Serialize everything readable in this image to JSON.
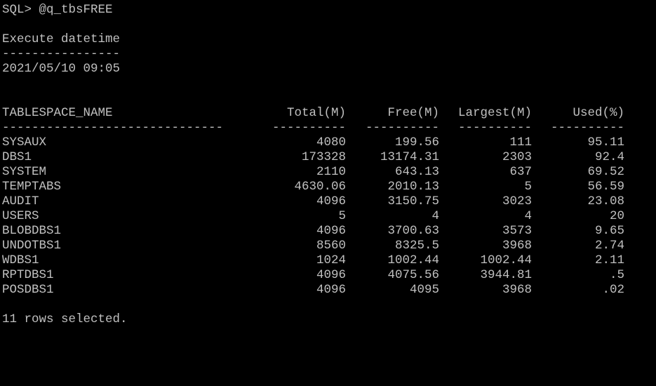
{
  "prompt": "SQL> @q_tbsFREE",
  "section": {
    "title": "Execute datetime",
    "underline": "----------------",
    "value": "2021/05/10 09:05"
  },
  "table": {
    "columns": [
      "TABLESPACE_NAME",
      "Total(M)",
      "Free(M)",
      "Largest(M)",
      "Used(%)"
    ],
    "underlines": [
      "------------------------------",
      "----------",
      "----------",
      "----------",
      "----------"
    ],
    "rows": [
      [
        "SYSAUX",
        "4080",
        "199.56",
        "111",
        "95.11"
      ],
      [
        "DBS1",
        "173328",
        "13174.31",
        "2303",
        "92.4"
      ],
      [
        "SYSTEM",
        "2110",
        "643.13",
        "637",
        "69.52"
      ],
      [
        "TEMPTABS",
        "4630.06",
        "2010.13",
        "5",
        "56.59"
      ],
      [
        "AUDIT",
        "4096",
        "3150.75",
        "3023",
        "23.08"
      ],
      [
        "USERS",
        "5",
        "4",
        "4",
        "20"
      ],
      [
        "BLOBDBS1",
        "4096",
        "3700.63",
        "3573",
        "9.65"
      ],
      [
        "UNDOTBS1",
        "8560",
        "8325.5",
        "3968",
        "2.74"
      ],
      [
        "WDBS1",
        "1024",
        "1002.44",
        "1002.44",
        "2.11"
      ],
      [
        "RPTDBS1",
        "4096",
        "4075.56",
        "3944.81",
        ".5"
      ],
      [
        "POSDBS1",
        "4096",
        "4095",
        "3968",
        ".02"
      ]
    ]
  },
  "footer": "11 rows selected.",
  "colors": {
    "background": "#000000",
    "text": "#c0c0c0"
  }
}
